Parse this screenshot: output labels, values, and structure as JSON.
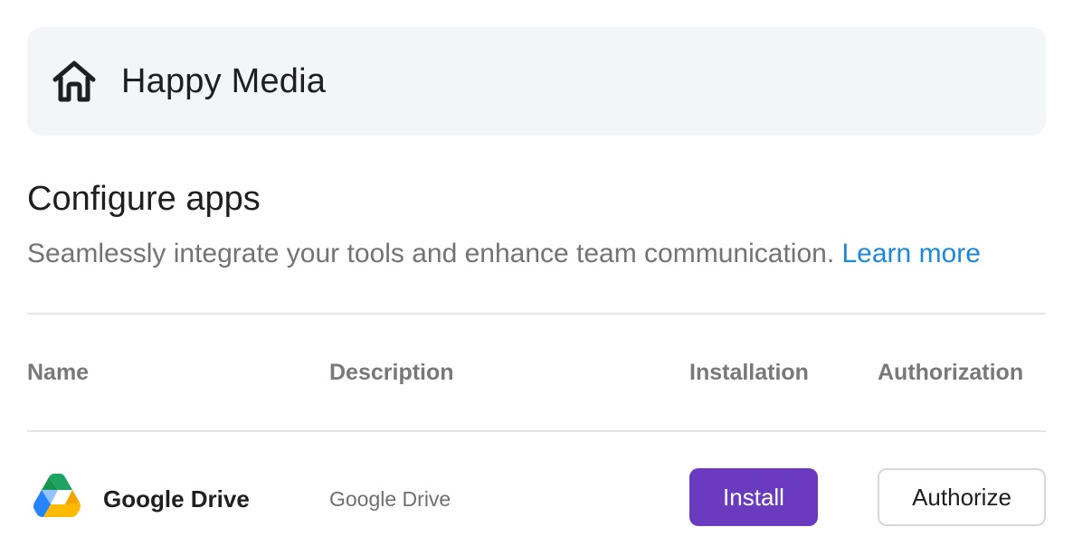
{
  "workspace": {
    "name": "Happy Media",
    "icon": "home-icon"
  },
  "page": {
    "title": "Configure apps",
    "subtitle": "Seamlessly integrate your tools and enhance team communication.",
    "learn_more": "Learn more"
  },
  "table": {
    "columns": [
      "Name",
      "Description",
      "Installation",
      "Authorization"
    ],
    "rows": [
      {
        "name": "Google Drive",
        "description": "Google Drive",
        "icon": "google-drive-icon",
        "install_label": "Install",
        "authorize_label": "Authorize"
      }
    ]
  },
  "colors": {
    "card_bg": "#f2f6f9",
    "link": "#1a8ad8",
    "install_button": "#6a3bbf",
    "header_text": "#787878"
  }
}
